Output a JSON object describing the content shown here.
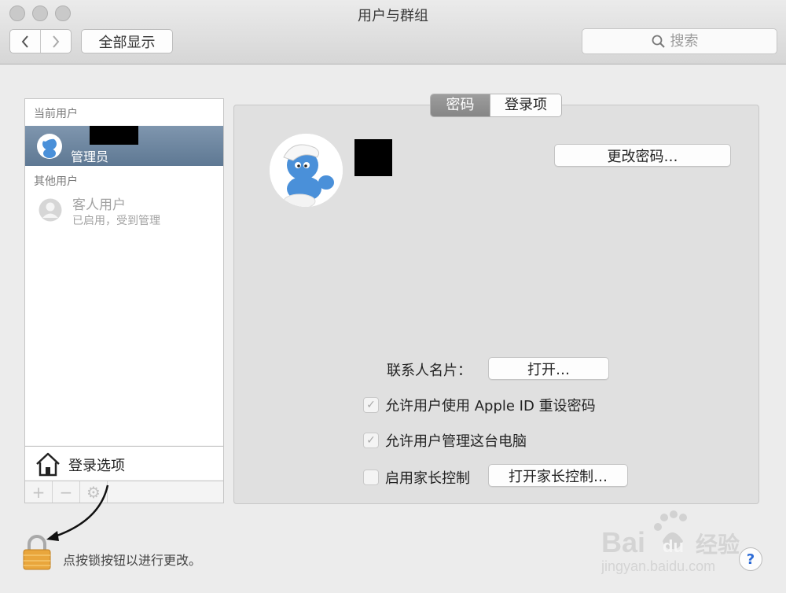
{
  "window": {
    "title": "用户与群组"
  },
  "toolbar": {
    "show_all_label": "全部显示",
    "search_placeholder": "搜索",
    "back_icon": "chevron-left-icon",
    "forward_icon": "chevron-right-icon"
  },
  "sidebar": {
    "current_header": "当前用户",
    "current_user": {
      "role": "管理员"
    },
    "other_header": "其他用户",
    "other_users": [
      {
        "name": "客人用户",
        "status": "已启用，受到管理"
      }
    ],
    "login_options_label": "登录选项",
    "tools": [
      "+",
      "−",
      "⚙"
    ]
  },
  "tabs": [
    {
      "label": "密码",
      "active": true
    },
    {
      "label": "登录项",
      "active": false
    }
  ],
  "password_tab": {
    "change_password_label": "更改密码…",
    "contact_card_label": "联系人名片：",
    "open_label": "打开…",
    "allow_appleid_reset": {
      "label": "允许用户使用 Apple ID 重设密码",
      "checked": true,
      "enabled": false
    },
    "allow_admin": {
      "label": "允许用户管理这台电脑",
      "checked": true,
      "enabled": false
    },
    "parental_controls": {
      "label": "启用家长控制",
      "checked": false,
      "enabled": false
    },
    "open_parental_label": "打开家长控制…"
  },
  "footer": {
    "lock_text": "点按锁按钮以进行更改。",
    "help_label": "?"
  },
  "watermark": {
    "brand": "Bai",
    "brand2": "du",
    "cn": "经验",
    "url": "jingyan.baidu.com"
  },
  "colors": {
    "selection": "#6b84a0",
    "panel": "#e0e0e0",
    "lock": "#e9a63c"
  }
}
